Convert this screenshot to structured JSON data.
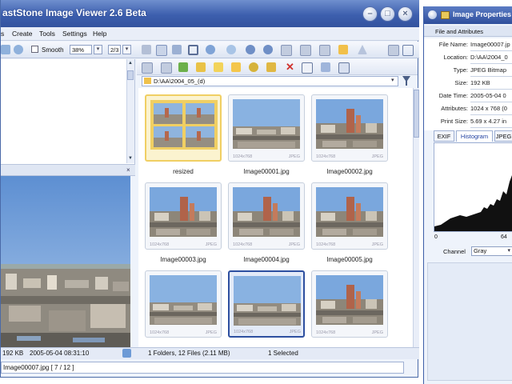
{
  "main_window": {
    "title": "astStone Image Viewer 2.6 Beta",
    "menu": [
      "s",
      "Create",
      "Tools",
      "Settings",
      "Help"
    ],
    "toolbar": {
      "smooth_label": "Smooth",
      "zoom_value": "38%",
      "fit_value": "2/3"
    },
    "path": "D:\\AA\\2004_05_(d)",
    "thumbnails": [
      {
        "name": "resized",
        "kind": "folder",
        "dims": "",
        "format": ""
      },
      {
        "name": "Image00001.jpg",
        "kind": "city-wide",
        "dims": "1024x768",
        "format": "JPEG"
      },
      {
        "name": "Image00002.jpg",
        "kind": "city-tower",
        "dims": "1024x768",
        "format": "JPEG"
      },
      {
        "name": "Image00003.jpg",
        "kind": "city-tower",
        "dims": "1024x768",
        "format": "JPEG"
      },
      {
        "name": "Image00004.jpg",
        "kind": "city-tower",
        "dims": "1024x768",
        "format": "JPEG"
      },
      {
        "name": "Image00005.jpg",
        "kind": "city-tower",
        "dims": "1024x768",
        "format": "JPEG"
      },
      {
        "name": "",
        "kind": "city-wide",
        "dims": "1024x768",
        "format": "JPEG"
      },
      {
        "name": "",
        "kind": "city-wide",
        "dims": "1024x768",
        "format": "JPEG",
        "selected": true
      },
      {
        "name": "",
        "kind": "city-tower",
        "dims": "1024x768",
        "format": "JPEG"
      }
    ],
    "preview_status": {
      "size": "192 KB",
      "datetime": "2005-05-04 08:31:10"
    },
    "browser_status": {
      "folders_files": "1 Folders, 12 Files (2.11 MB)",
      "selected": "1 Selected"
    },
    "bottom_status": "Image00007.jpg [ 7 / 12 ]"
  },
  "properties_window": {
    "title": "Image Properties",
    "section": "File and Attributes",
    "rows": [
      {
        "key": "File Name:",
        "value": "Image00007.jp"
      },
      {
        "key": "Location:",
        "value": "D:\\AA\\2004_0"
      },
      {
        "key": "Type:",
        "value": "JPEG Bitmap"
      },
      {
        "key": "Size:",
        "value": "192 KB"
      },
      {
        "key": "Date Time:",
        "value": "2005-05-04 0"
      },
      {
        "key": "Attributes:",
        "value": "1024 x 768 (0"
      },
      {
        "key": "Print Size:",
        "value": "5.69 x 4.27 in"
      }
    ],
    "tabs": [
      "EXIF",
      "Histogram",
      "JPEG"
    ],
    "active_tab": "Histogram",
    "hist_min_label": "0",
    "hist_mid_label": "64",
    "channel_label": "Channel",
    "channel_value": "Gray"
  },
  "colors": {
    "titlebar": "#3d5fae",
    "selection": "#2d4fa0",
    "folder_highlight": "#f0cf63",
    "sky": "#7fa9dc"
  }
}
